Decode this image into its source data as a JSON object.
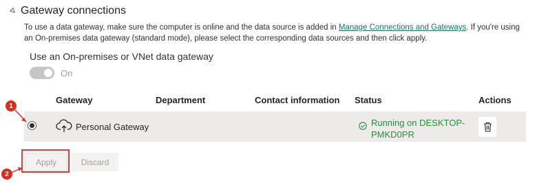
{
  "section": {
    "title": "Gateway connections",
    "desc_part1": "To use a data gateway, make sure the computer is online and the data source is added in ",
    "desc_link": "Manage Connections and Gateways",
    "desc_part2": ". If you're using an On-premises data gateway (standard mode), please select the corresponding data sources and then click apply."
  },
  "toggle": {
    "label": "Use an On-premises or VNet data gateway",
    "state_text": "On"
  },
  "table": {
    "headers": {
      "gateway": "Gateway",
      "department": "Department",
      "contact": "Contact information",
      "status": "Status",
      "actions": "Actions"
    },
    "rows": [
      {
        "name": "Personal Gateway",
        "department": "",
        "contact": "",
        "status": "Running on DESKTOP-PMKD0PR",
        "icon": "cloud-upload-icon",
        "status_icon": "check-circle-icon",
        "action_icon": "delete-icon"
      }
    ]
  },
  "buttons": {
    "apply": "Apply",
    "discard": "Discard"
  },
  "markers": [
    "1",
    "2"
  ],
  "colors": {
    "link": "#117865",
    "status_ok": "#2b8a3e",
    "marker": "#d92d20",
    "row_bg": "#edebe9"
  }
}
